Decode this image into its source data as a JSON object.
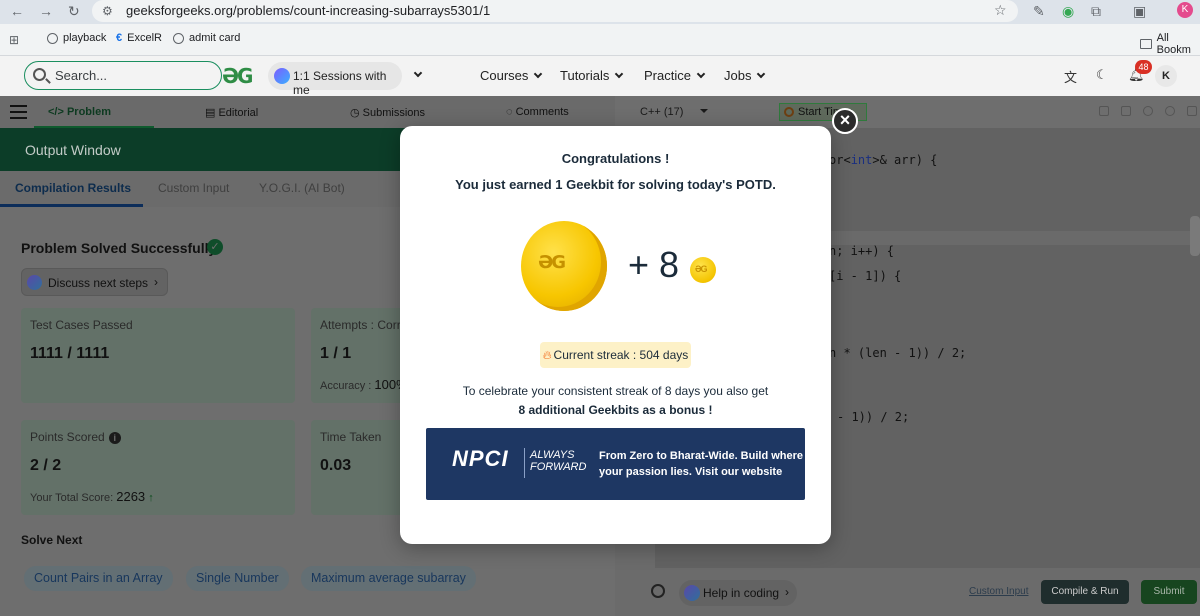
{
  "browser": {
    "url": "geeksforgeeks.org/problems/count-increasing-subarrays5301/1",
    "bookmarks": [
      "playback",
      "ExcelR",
      "admit card"
    ],
    "all_bookmarks": "All Bookm"
  },
  "header": {
    "search_placeholder": "Search...",
    "logo": "GG",
    "sessions": "1:1 Sessions with me",
    "nav": [
      "Courses",
      "Tutorials",
      "Practice",
      "Jobs"
    ],
    "notification_count": "48",
    "avatar_letter": "K"
  },
  "tabs": {
    "problem": "Problem",
    "editorial": "Editorial",
    "submissions": "Submissions",
    "comments": "Comments"
  },
  "output": {
    "title": "Output Window",
    "result_tabs": [
      "Compilation Results",
      "Custom Input",
      "Y.O.G.I. (AI Bot)"
    ],
    "solved_title": "Problem Solved Successfully",
    "discuss_label": "Discuss next steps",
    "cards": {
      "test_cases": {
        "label": "Test Cases Passed",
        "value": "1111 / 1111"
      },
      "attempts": {
        "label": "Attempts : Corr",
        "value": "1 / 1",
        "sub_label": "Accuracy :",
        "sub_value": "100%"
      },
      "points": {
        "label": "Points Scored",
        "value": "2 / 2",
        "sub_label": "Your Total Score:",
        "sub_value": "2263"
      },
      "time": {
        "label": "Time Taken",
        "value": "0.03"
      }
    },
    "solve_next_title": "Solve Next",
    "solve_next": [
      "Count Pairs in an Array",
      "Single Number",
      "Maximum average subarray"
    ]
  },
  "editor": {
    "language": "C++ (17)",
    "start_timer": "Start Timer",
    "code_lines": [
      {
        "pre": "or<",
        "kw": "int",
        "post": ">& arr) {"
      },
      {
        "pre": "n; i++) {",
        "kw": "",
        "post": ""
      },
      {
        "pre": "[i - 1]) {",
        "kw": "",
        "post": ""
      },
      {
        "pre": "n * (len - 1)) / 2;",
        "kw": "",
        "post": ""
      },
      {
        "pre": "- 1)) / 2;",
        "kw": "",
        "post": ""
      }
    ],
    "help_label": "Help in coding",
    "custom_input": "Custom Input",
    "compile_run": "Compile & Run",
    "submit": "Submit"
  },
  "modal": {
    "congrats": "Congratulations !",
    "earned": "You just earned 1 Geekbit for solving today's POTD.",
    "plus_value": "+ 8",
    "streak": "Current streak : 504 days",
    "celebrate_line1": "To celebrate your consistent streak of 8 days you also get",
    "celebrate_line2": "8 additional Geekbits as a bonus !",
    "banner": {
      "logo": "NPCI",
      "tagline_top": "ALWAYS",
      "tagline_bottom": "FORWARD",
      "text_line1": "From Zero to Bharat-Wide. Build where",
      "text_line2": "your passion lies. Visit our website"
    },
    "close_symbol": "×"
  },
  "colors": {
    "gfg_green": "#2f8d46",
    "output_header": "#0c3d28",
    "banner_bg": "#1e3763",
    "streak_bg": "#fdf1c7",
    "coin_gold": "#f7c600"
  }
}
